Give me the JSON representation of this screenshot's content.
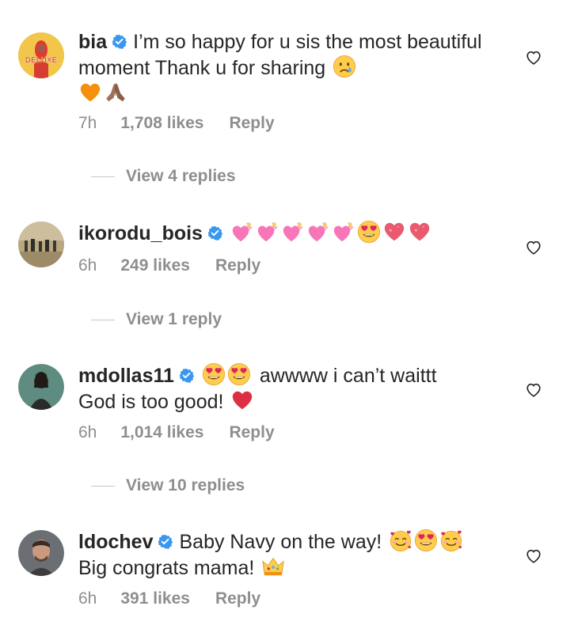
{
  "comments": [
    {
      "username": "bia",
      "text": "I’m so happy for u sis the most beautiful moment Thank u for sharing",
      "time": "7h",
      "likes": "1,708 likes",
      "reply": "Reply",
      "view_replies": "View 4 replies",
      "avatar_text": "DELUXE",
      "emojis": [
        "crying-face",
        "orange-heart",
        "folded-hands"
      ]
    },
    {
      "username": "ikorodu_bois",
      "text": "",
      "time": "6h",
      "likes": "249 likes",
      "reply": "Reply",
      "view_replies": "View 1 reply",
      "emojis": [
        "heart-with-ribbon",
        "heart-with-ribbon",
        "heart-with-ribbon",
        "heart-with-ribbon",
        "heart-with-ribbon",
        "heart-eyes",
        "sparkling-heart",
        "sparkling-heart"
      ]
    },
    {
      "username": "mdollas11",
      "text": "awwww i can’t waittt",
      "text2": "God is too good!",
      "time": "6h",
      "likes": "1,014 likes",
      "reply": "Reply",
      "view_replies": "View 10 replies",
      "emojis": [
        "heart-eyes",
        "heart-eyes",
        "red-heart"
      ]
    },
    {
      "username": "ldochev",
      "text": "Baby Navy on the way!",
      "text2": "Big congrats mama!",
      "time": "6h",
      "likes": "391 likes",
      "reply": "Reply",
      "emojis": [
        "smiling-face-with-hearts",
        "heart-eyes",
        "smiling-face-with-hearts",
        "crown"
      ]
    }
  ],
  "colors": {
    "text": "#262626",
    "secondary": "#8e8e8e",
    "verified": "#3897f0"
  }
}
